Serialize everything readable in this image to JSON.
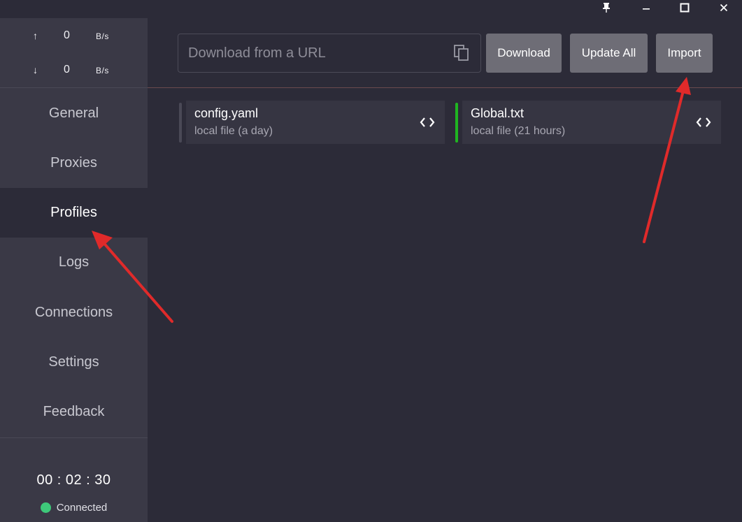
{
  "window": {
    "pin_icon": "pin-icon",
    "minimize_icon": "minimize-icon",
    "maximize_icon": "maximize-icon",
    "close_icon": "close-icon"
  },
  "traffic": {
    "upload": {
      "arrow": "↑",
      "value": "0",
      "unit": "B/s"
    },
    "download": {
      "arrow": "↓",
      "value": "0",
      "unit": "B/s"
    }
  },
  "nav": {
    "items": [
      {
        "label": "General"
      },
      {
        "label": "Proxies"
      },
      {
        "label": "Profiles",
        "active": true
      },
      {
        "label": "Logs"
      },
      {
        "label": "Connections"
      },
      {
        "label": "Settings"
      },
      {
        "label": "Feedback"
      }
    ]
  },
  "footer": {
    "timer": "00 : 02 : 30",
    "status": "Connected",
    "status_color": "#3ec97a"
  },
  "toolbar": {
    "url_placeholder": "Download from a URL",
    "url_value": "",
    "download_label": "Download",
    "update_all_label": "Update All",
    "import_label": "Import"
  },
  "profiles": [
    {
      "name": "config.yaml",
      "meta": "local file (a day)",
      "bar_color": "#4a4956",
      "selected": false
    },
    {
      "name": "Global.txt",
      "meta": "local file (21 hours)",
      "bar_color": "#1fb521",
      "selected": true
    }
  ],
  "colors": {
    "background": "#2c2b38",
    "sidebar": "#3a3946",
    "button": "#6e6d76",
    "annotation": "#e02a2a"
  }
}
